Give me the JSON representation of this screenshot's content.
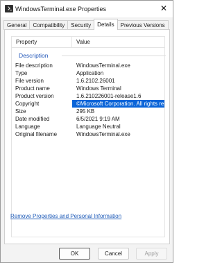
{
  "window": {
    "title": "WindowsTerminal.exe Properties",
    "close_glyph": "✕"
  },
  "tabs": [
    {
      "label": "General"
    },
    {
      "label": "Compatibility"
    },
    {
      "label": "Security"
    },
    {
      "label": "Details",
      "active": true
    },
    {
      "label": "Previous Versions"
    }
  ],
  "details": {
    "header": {
      "property": "Property",
      "value": "Value"
    },
    "section": "Description",
    "rows": [
      {
        "property": "File description",
        "value": "WindowsTerminal.exe"
      },
      {
        "property": "Type",
        "value": "Application"
      },
      {
        "property": "File version",
        "value": "1.6.2102.26001"
      },
      {
        "property": "Product name",
        "value": "Windows Terminal"
      },
      {
        "property": "Product version",
        "value": "1.6.210226001-release1.6"
      },
      {
        "property": "Copyright",
        "value": "©Microsoft Corporation.  All rights reserv...",
        "selected": true
      },
      {
        "property": "Size",
        "value": "295 KB"
      },
      {
        "property": "Date modified",
        "value": "6/5/2021 9:19 AM"
      },
      {
        "property": "Language",
        "value": "Language Neutral"
      },
      {
        "property": "Original filename",
        "value": "WindowsTerminal.exe"
      }
    ]
  },
  "link": {
    "label": "Remove Properties and Personal Information"
  },
  "buttons": {
    "ok": "OK",
    "cancel": "Cancel",
    "apply": "Apply"
  },
  "colors": {
    "accent": "#0a64d8",
    "section": "#2156b8",
    "link": "#1e5bb8"
  }
}
